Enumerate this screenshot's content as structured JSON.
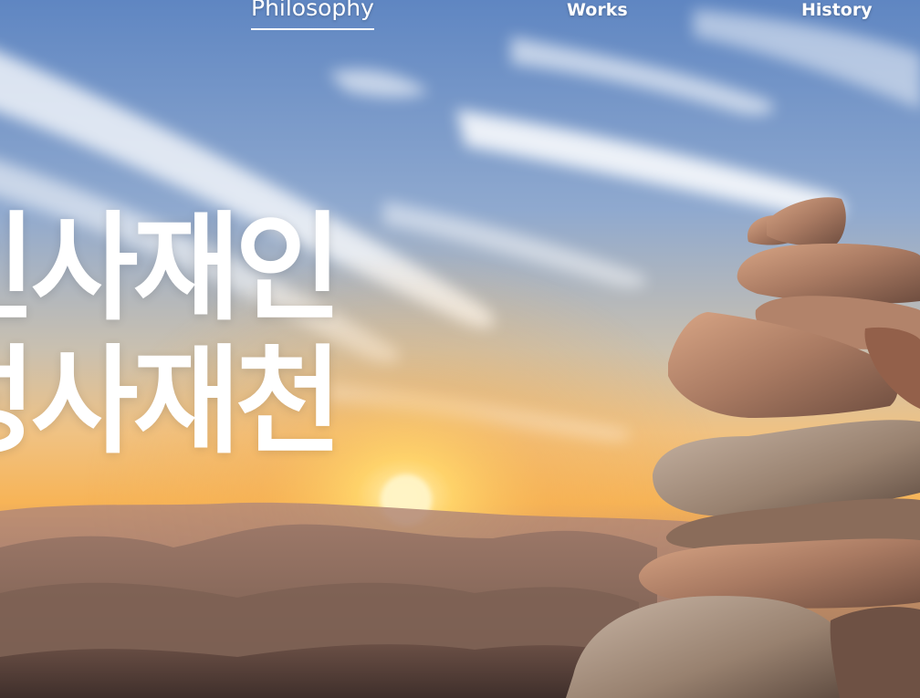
{
  "nav": {
    "items": [
      {
        "label": "Philosophy",
        "active": true
      },
      {
        "label": "Works",
        "active": false
      },
      {
        "label": "History",
        "active": false
      }
    ]
  },
  "hero": {
    "line1": "인사재인",
    "line2": "성사재천",
    "background": "sunset-mountains-stone-cairn-photo"
  },
  "colors": {
    "nav_text": "#ffffff",
    "sky_top": "#5f86c2",
    "sun": "#ffd56a",
    "mountains": "#6e5549",
    "rock": "#a97a62"
  }
}
